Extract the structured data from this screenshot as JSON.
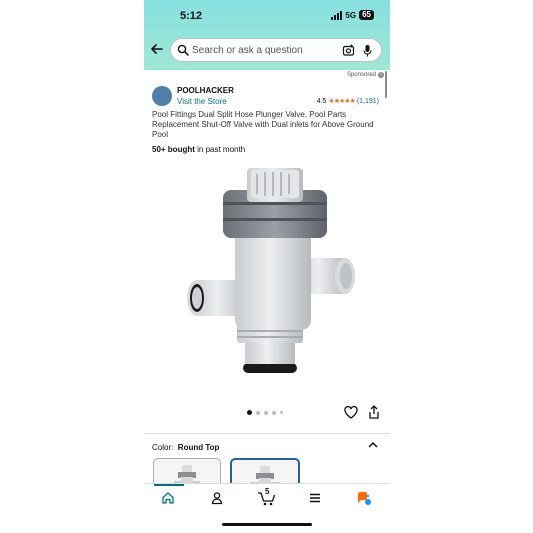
{
  "status": {
    "time": "5:12",
    "network": "5G",
    "battery": "65"
  },
  "search": {
    "placeholder": "Search or ask a question"
  },
  "sponsored_label": "Sponsored",
  "seller": {
    "name": "POOLHACKER",
    "visit_link": "Visit the Store"
  },
  "rating": {
    "value": "4.5",
    "stars": "★★★★★",
    "count": "(1,191)"
  },
  "product": {
    "title": "Pool Fittings Dual Split Hose Plunger Valve, Pool Parts Replacement Shut-Off Valve with Dual inlets for Above Ground Pool",
    "bought_bold": "50+ bought",
    "bought_rest": " in past month"
  },
  "carousel": {
    "total": 5,
    "active": 1
  },
  "color": {
    "label": "Color:",
    "value": "Round Top"
  },
  "tabbar": {
    "cart_count": "5"
  },
  "colors": {
    "accent": "#007185",
    "star": "#de7921",
    "header": "#86e0df",
    "selected": "#2162a1"
  },
  "icons": [
    "back-arrow-icon",
    "search-icon",
    "camera-icon",
    "mic-icon",
    "heart-icon",
    "share-icon",
    "chevron-up-icon",
    "home-icon",
    "account-icon",
    "cart-icon",
    "menu-icon",
    "rufus-icon"
  ]
}
